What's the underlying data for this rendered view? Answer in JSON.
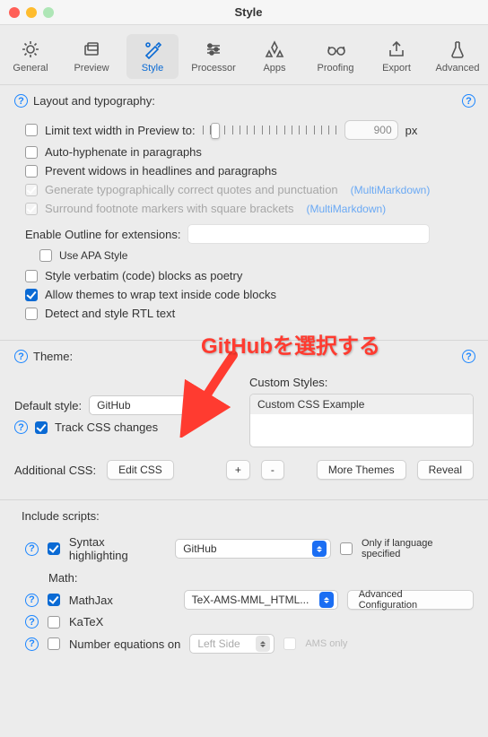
{
  "window": {
    "title": "Style"
  },
  "toolbar": {
    "items": [
      {
        "label": "General"
      },
      {
        "label": "Preview"
      },
      {
        "label": "Style"
      },
      {
        "label": "Processor"
      },
      {
        "label": "Apps"
      },
      {
        "label": "Proofing"
      },
      {
        "label": "Export"
      },
      {
        "label": "Advanced"
      }
    ]
  },
  "layout": {
    "heading": "Layout and typography:",
    "limit": "Limit text width in Preview to:",
    "limit_value": "900",
    "limit_unit": "px",
    "auto_hyphen": "Auto-hyphenate in paragraphs",
    "prevent_widows": "Prevent widows in headlines and paragraphs",
    "smart_quotes": "Generate typographically correct quotes and punctuation",
    "footnote_brackets": "Surround footnote markers with square brackets",
    "mmd": "(MultiMarkdown)",
    "enable_outline": "Enable Outline for extensions:",
    "use_apa": "Use APA Style",
    "poetry": "Style verbatim (code) blocks as poetry",
    "wrap_code": "Allow themes to wrap text inside code blocks",
    "rtl": "Detect and style RTL text"
  },
  "theme": {
    "heading": "Theme:",
    "default_style_label": "Default style:",
    "default_style_value": "GitHub",
    "track_css": "Track CSS changes",
    "custom_styles_label": "Custom Styles:",
    "custom_styles_item": "Custom CSS Example",
    "additional_css_label": "Additional CSS:",
    "edit_css": "Edit CSS",
    "plus": "+",
    "minus": "-",
    "more_themes": "More Themes",
    "reveal": "Reveal"
  },
  "scripts": {
    "heading": "Include scripts:",
    "syntax_highlighting": "Syntax highlighting",
    "syntax_style_value": "GitHub",
    "only_if_lang": "Only if language specified",
    "math_label": "Math:",
    "mathjax": "MathJax",
    "mathjax_value": "TeX-AMS-MML_HTML...",
    "advanced_config": "Advanced Configuration",
    "katex": "KaTeX",
    "number_eq": "Number equations on",
    "number_eq_value": "Left Side",
    "ams_only": "AMS only"
  },
  "annotation": {
    "text": "GitHubを選択する"
  }
}
